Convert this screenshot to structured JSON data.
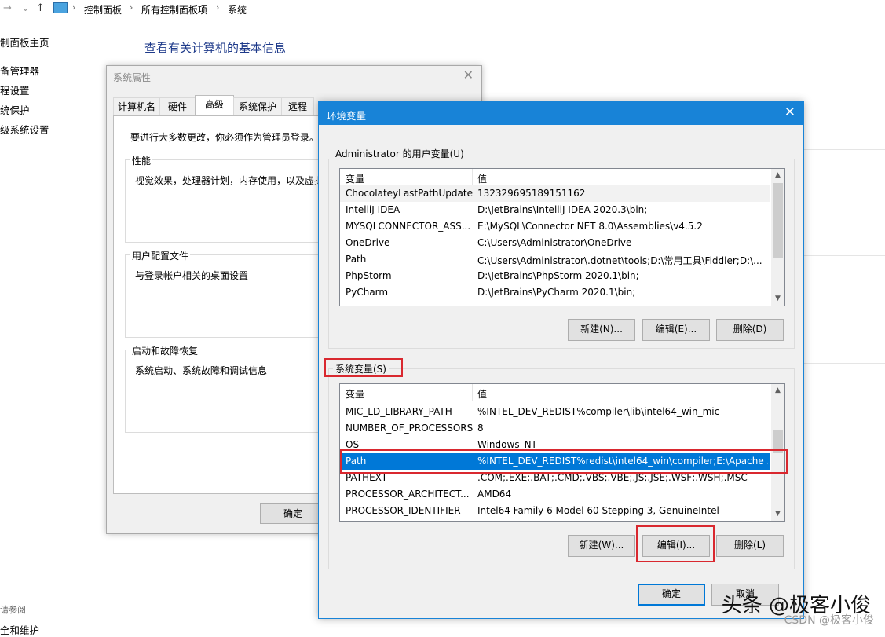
{
  "breadcrumb": [
    "控制面板",
    "所有控制面板项",
    "系统"
  ],
  "left_nav": [
    "制面板主页",
    "备管理器",
    "程设置",
    "统保护",
    "级系统设置"
  ],
  "left_nav_bottom": [
    "请参阅",
    "全和维护"
  ],
  "main_title": "查看有关计算机的基本信息",
  "sys_props": {
    "title": "系统属性",
    "tabs": [
      "计算机名",
      "硬件",
      "高级",
      "系统保护",
      "远程"
    ],
    "intro": "要进行大多数更改，你必须作为管理员登录。",
    "groups": [
      {
        "title": "性能",
        "text": "视觉效果，处理器计划，内存使用，以及虚拟"
      },
      {
        "title": "用户配置文件",
        "text": "与登录帐户相关的桌面设置"
      },
      {
        "title": "启动和故障恢复",
        "text": "系统启动、系统故障和调试信息"
      }
    ],
    "ok_label": "确定"
  },
  "env": {
    "title": "环境变量",
    "user_group_label": "Administrator 的用户变量(U)",
    "sys_group_label": "系统变量(S)",
    "col_var": "变量",
    "col_val": "值",
    "user_vars": [
      {
        "name": "ChocolateyLastPathUpdate",
        "value": "132329695189151162"
      },
      {
        "name": "IntelliJ IDEA",
        "value": "D:\\JetBrains\\IntelliJ IDEA 2020.3\\bin;"
      },
      {
        "name": "MYSQLCONNECTOR_ASS...",
        "value": "E:\\MySQL\\Connector NET 8.0\\Assemblies\\v4.5.2"
      },
      {
        "name": "OneDrive",
        "value": "C:\\Users\\Administrator\\OneDrive"
      },
      {
        "name": "Path",
        "value": "C:\\Users\\Administrator\\.dotnet\\tools;D:\\常用工具\\Fiddler;D:\\..."
      },
      {
        "name": "PhpStorm",
        "value": "D:\\JetBrains\\PhpStorm 2020.1\\bin;"
      },
      {
        "name": "PyCharm",
        "value": "D:\\JetBrains\\PyCharm 2020.1\\bin;"
      }
    ],
    "sys_vars": [
      {
        "name": "MIC_LD_LIBRARY_PATH",
        "value": "%INTEL_DEV_REDIST%compiler\\lib\\intel64_win_mic"
      },
      {
        "name": "NUMBER_OF_PROCESSORS",
        "value": "8"
      },
      {
        "name": "OS",
        "value": "Windows_NT"
      },
      {
        "name": "Path",
        "value": "%INTEL_DEV_REDIST%redist\\intel64_win\\compiler;E:\\Apache ..."
      },
      {
        "name": "PATHEXT",
        "value": ".COM;.EXE;.BAT;.CMD;.VBS;.VBE;.JS;.JSE;.WSF;.WSH;.MSC"
      },
      {
        "name": "PROCESSOR_ARCHITECT...",
        "value": "AMD64"
      },
      {
        "name": "PROCESSOR_IDENTIFIER",
        "value": "Intel64 Family 6 Model 60 Stepping 3, GenuineIntel"
      }
    ],
    "user_buttons": {
      "new": "新建(N)...",
      "edit": "编辑(E)...",
      "delete": "删除(D)"
    },
    "sys_buttons": {
      "new": "新建(W)...",
      "edit": "编辑(I)...",
      "delete": "删除(L)"
    },
    "ok_label": "确定",
    "cancel_label": "取消"
  },
  "watermark": {
    "main": "头条 @极客小俊",
    "sub": "CSDN @极客小俊"
  },
  "colors": {
    "accent": "#0078d7",
    "highlight_box": "#d9282f",
    "title_bar": "#1883d7"
  }
}
